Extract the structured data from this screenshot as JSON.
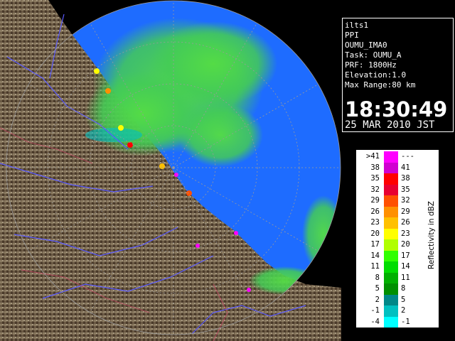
{
  "info": {
    "site": "ilts1",
    "product": "PPI",
    "station": "OUMU_IMA0",
    "task": "Task: OUMU_A",
    "prf": "PRF: 1800Hz",
    "elevation": "Elevation:1.0",
    "max_range": "Max Range:80 km",
    "time": "18:30:49",
    "date": "25 MAR 2010 JST"
  },
  "legend": {
    "axis_label": "Reflectivity in dBZ",
    "rows": [
      {
        "left": ">41",
        "right": "---",
        "color": "#ff00ff"
      },
      {
        "left": "38",
        "right": "41",
        "color": "#d000d0"
      },
      {
        "left": "35",
        "right": "38",
        "color": "#ff0000"
      },
      {
        "left": "32",
        "right": "35",
        "color": "#e80030"
      },
      {
        "left": "29",
        "right": "32",
        "color": "#ff5000"
      },
      {
        "left": "26",
        "right": "29",
        "color": "#ff9000"
      },
      {
        "left": "23",
        "right": "26",
        "color": "#ffc000"
      },
      {
        "left": "20",
        "right": "23",
        "color": "#ffff00"
      },
      {
        "left": "17",
        "right": "20",
        "color": "#b0ff00"
      },
      {
        "left": "14",
        "right": "17",
        "color": "#30ff00"
      },
      {
        "left": "11",
        "right": "14",
        "color": "#00dd00"
      },
      {
        "left": "8",
        "right": "11",
        "color": "#00b000"
      },
      {
        "left": "5",
        "right": "8",
        "color": "#009000"
      },
      {
        "left": "2",
        "right": "5",
        "color": "#008888"
      },
      {
        "left": "-1",
        "right": "2",
        "color": "#00c0c0"
      },
      {
        "left": "-4",
        "right": "-1",
        "color": "#00ffff"
      }
    ]
  },
  "colors": {
    "ocean": "#1e6cff",
    "land": "#6b5a45",
    "range_ring": "#9a9a9a",
    "rivers": "#5a5aff",
    "echo_light": "#66ee55",
    "echo_heavy": "#ff00ff"
  },
  "map": {
    "radar_range_km": 80,
    "range_rings_km": [
      20,
      40,
      60,
      80
    ],
    "azimuth_step_deg": 30
  }
}
